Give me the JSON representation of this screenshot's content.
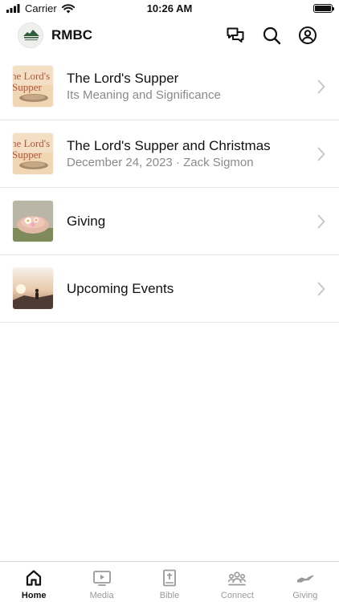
{
  "status_bar": {
    "carrier": "Carrier",
    "time": "10:26 AM"
  },
  "header": {
    "title": "RMBC",
    "logo_text": "ROCKY MOUNTAIN BIBLE CHURCH"
  },
  "thumb_text": {
    "lords_supper": "he Lord's\nSupper"
  },
  "items": [
    {
      "title": "The Lord's Supper",
      "subtitle": "Its Meaning and Significance",
      "thumb": "lords-supper"
    },
    {
      "title": "The Lord's Supper and Christmas",
      "subtitle": "December 24, 2023 · Zack Sigmon",
      "thumb": "lords-supper"
    },
    {
      "title": "Giving",
      "subtitle": "",
      "thumb": "giving"
    },
    {
      "title": "Upcoming Events",
      "subtitle": "",
      "thumb": "events"
    }
  ],
  "tabs": [
    {
      "label": "Home",
      "icon": "home-icon",
      "active": true
    },
    {
      "label": "Media",
      "icon": "media-icon",
      "active": false
    },
    {
      "label": "Bible",
      "icon": "bible-icon",
      "active": false
    },
    {
      "label": "Connect",
      "icon": "connect-icon",
      "active": false
    },
    {
      "label": "Giving",
      "icon": "giving-icon",
      "active": false
    }
  ],
  "colors": {
    "active_tab": "#111111",
    "inactive_tab": "#9a9a9a",
    "subtitle": "#8a8a8e",
    "divider": "#e6e6e6"
  }
}
